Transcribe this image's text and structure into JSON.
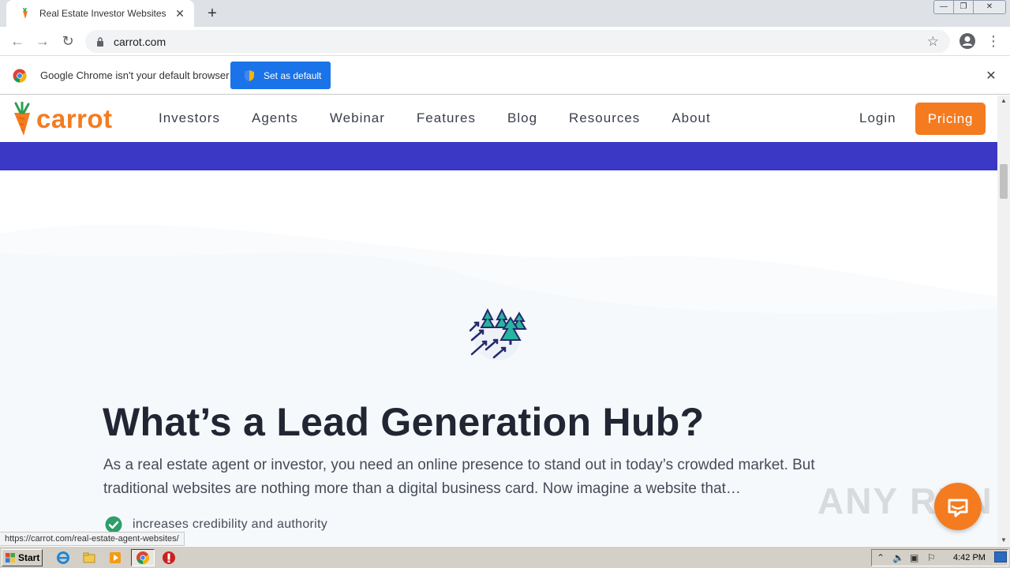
{
  "browser": {
    "tab_title": "Real Estate Investor Websites | Rea",
    "url": "carrot.com",
    "infobar_text": "Google Chrome isn't your default browser",
    "set_default_label": "Set as default",
    "status_url": "https://carrot.com/real-estate-agent-websites/"
  },
  "site": {
    "logo_text": "carrot",
    "nav": [
      "Investors",
      "Agents",
      "Webinar",
      "Features",
      "Blog",
      "Resources",
      "About"
    ],
    "login_label": "Login",
    "pricing_label": "Pricing"
  },
  "hero": {
    "heading": "What’s a Lead Generation Hub?",
    "paragraph": "As a real estate agent or investor, you need an online presence to stand out in today’s crowded market. But traditional websites are nothing more than a digital business card. Now imagine a website that…",
    "bullet_1": "increases credibility and authority"
  },
  "watermark": "ANY RUN",
  "taskbar": {
    "start_label": "Start",
    "clock": "4:42 PM"
  },
  "colors": {
    "brand_orange": "#f47b20",
    "banner_blue": "#3a38c4",
    "chrome_blue": "#1a73e8"
  }
}
